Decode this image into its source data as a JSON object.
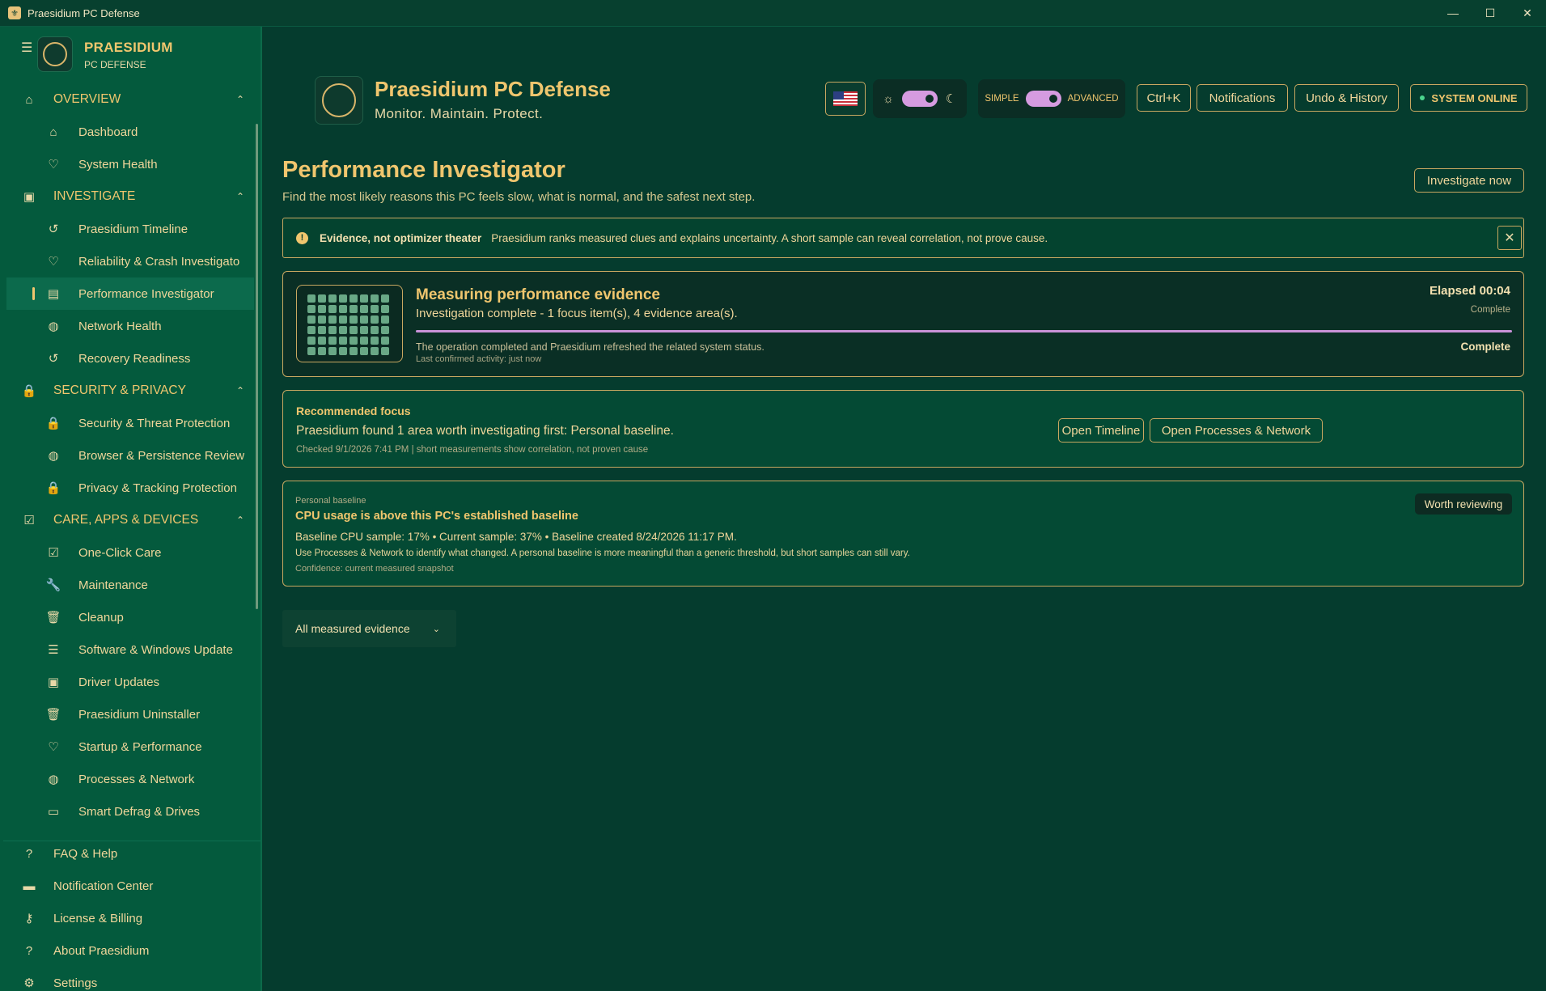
{
  "window": {
    "title": "Praesidium PC Defense",
    "controls": [
      "—",
      "☐",
      "✕"
    ]
  },
  "sidebar": {
    "brand_name": "PRAESIDIUM",
    "brand_sub": "PC DEFENSE",
    "sections": [
      {
        "label": "OVERVIEW",
        "icon": "home-icon",
        "glyph": "⌂",
        "items": [
          {
            "label": "Dashboard",
            "icon": "home-icon",
            "glyph": "⌂"
          },
          {
            "label": "System Health",
            "icon": "pulse-icon",
            "glyph": "♡"
          }
        ]
      },
      {
        "label": "INVESTIGATE",
        "icon": "chip-icon",
        "glyph": "▣",
        "items": [
          {
            "label": "Praesidium Timeline",
            "icon": "history-icon",
            "glyph": "↺"
          },
          {
            "label": "Reliability & Crash Investigato",
            "icon": "pulse-icon",
            "glyph": "♡"
          },
          {
            "label": "Performance Investigator",
            "icon": "report-icon",
            "glyph": "▤",
            "active": true
          },
          {
            "label": "Network Health",
            "icon": "globe-icon",
            "glyph": "◍"
          },
          {
            "label": "Recovery Readiness",
            "icon": "restore-icon",
            "glyph": "↺"
          }
        ]
      },
      {
        "label": "SECURITY & PRIVACY",
        "icon": "lock-icon",
        "glyph": "🔒",
        "items": [
          {
            "label": "Security & Threat Protection",
            "icon": "lock-icon",
            "glyph": "🔒"
          },
          {
            "label": "Browser & Persistence Review",
            "icon": "globe-icon",
            "glyph": "◍"
          },
          {
            "label": "Privacy & Tracking Protection",
            "icon": "lock-icon",
            "glyph": "🔒"
          }
        ]
      },
      {
        "label": "CARE, APPS & DEVICES",
        "icon": "checkbox-icon",
        "glyph": "☑",
        "items": [
          {
            "label": "One-Click Care",
            "icon": "checkbox-icon",
            "glyph": "☑"
          },
          {
            "label": "Maintenance",
            "icon": "wrench-icon",
            "glyph": "🔧"
          },
          {
            "label": "Cleanup",
            "icon": "trash-icon",
            "glyph": "🗑"
          },
          {
            "label": "Software & Windows Update",
            "icon": "list-icon",
            "glyph": "☰"
          },
          {
            "label": "Driver Updates",
            "icon": "chip-icon",
            "glyph": "▣"
          },
          {
            "label": "Praesidium Uninstaller",
            "icon": "trash-icon",
            "glyph": "🗑"
          },
          {
            "label": "Startup & Performance",
            "icon": "pulse-icon",
            "glyph": "♡"
          },
          {
            "label": "Processes & Network",
            "icon": "globe-icon",
            "glyph": "◍"
          },
          {
            "label": "Smart Defrag & Drives",
            "icon": "folder-icon",
            "glyph": "▭"
          }
        ]
      }
    ],
    "footer": [
      {
        "label": "FAQ & Help",
        "icon": "help-icon",
        "glyph": "?"
      },
      {
        "label": "Notification Center",
        "icon": "message-icon",
        "glyph": "▬"
      },
      {
        "label": "License & Billing",
        "icon": "key-icon",
        "glyph": "⚷"
      },
      {
        "label": "About Praesidium",
        "icon": "help-icon",
        "glyph": "?"
      },
      {
        "label": "Settings",
        "icon": "gear-icon",
        "glyph": "⚙"
      }
    ]
  },
  "header": {
    "title": "Praesidium PC Defense",
    "subtitle": "Monitor. Maintain. Protect.",
    "mode_simple": "SIMPLE",
    "mode_advanced": "ADVANCED",
    "buttons": {
      "shortcut": "Ctrl+K",
      "notifications": "Notifications",
      "undo": "Undo & History",
      "status": "SYSTEM ONLINE"
    }
  },
  "page": {
    "title": "Performance Investigator",
    "subtitle": "Find the most likely reasons this PC feels slow, what is normal, and the safest next step.",
    "investigate_btn": "Investigate now"
  },
  "notice": {
    "strong": "Evidence, not optimizer theater",
    "text": "Praesidium ranks measured clues and explains uncertainty. A short sample can reveal correlation, not prove cause."
  },
  "progress": {
    "title": "Measuring performance evidence",
    "status": "Investigation complete - 1 focus item(s), 4 evidence area(s).",
    "elapsed": "Elapsed 00:04",
    "elapsed_sub": "Complete",
    "percent": 100,
    "message": "The operation completed and Praesidium refreshed the related system status.",
    "activity": "Last confirmed activity: just now",
    "state": "Complete"
  },
  "focus": {
    "title": "Recommended focus",
    "text": "Praesidium found 1 area worth investigating first: Personal baseline.",
    "meta": "Checked 9/1/2026 7:41 PM | short measurements show correlation, not proven cause",
    "btn_timeline": "Open Timeline",
    "btn_processes": "Open Processes & Network"
  },
  "baseline": {
    "category": "Personal baseline",
    "title": "CPU usage is above this PC's established baseline",
    "line1": "Baseline CPU sample: 17% • Current sample: 37% • Baseline created 8/24/2026 11:17 PM.",
    "line2": "Use Processes & Network to identify what changed. A personal baseline is more meaningful than a generic threshold, but short samples can still vary.",
    "line3": "Confidence: current measured snapshot",
    "badge": "Worth reviewing"
  },
  "filter": {
    "selected": "All measured evidence"
  }
}
